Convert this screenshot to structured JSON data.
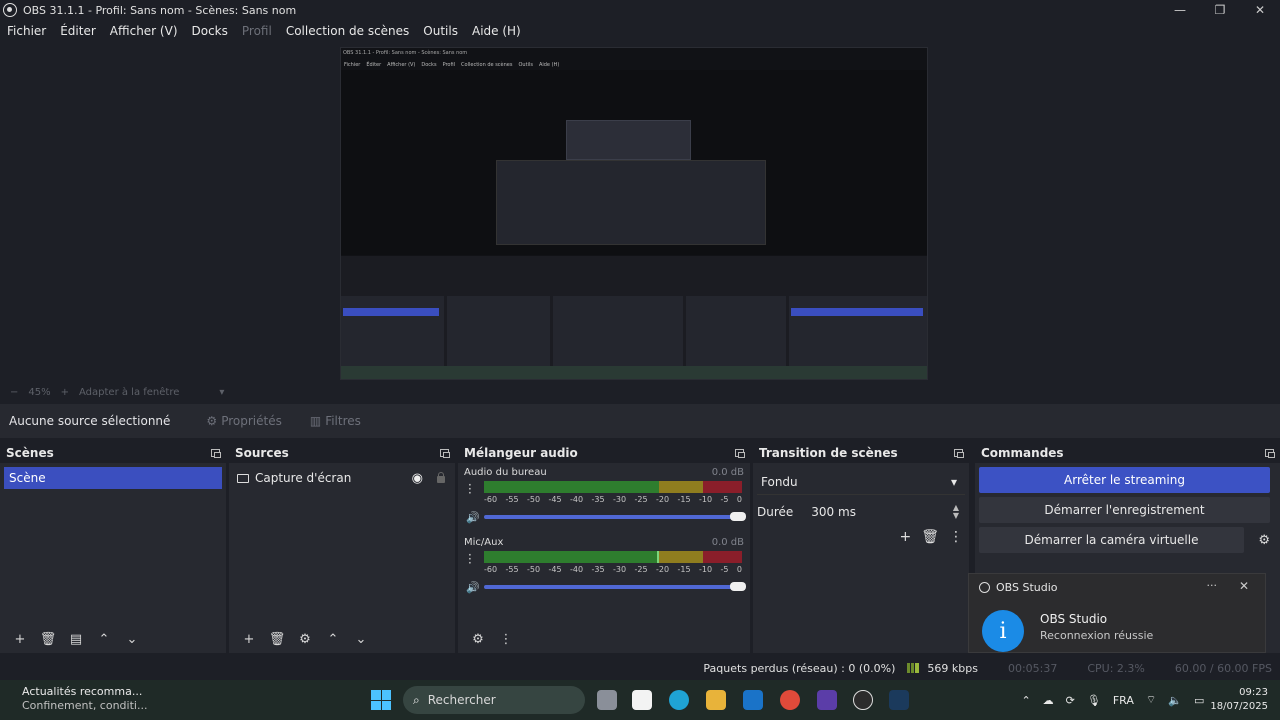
{
  "window": {
    "title": "OBS 31.1.1 - Profil: Sans nom - Scènes: Sans nom",
    "controls": [
      "minimize",
      "maximize",
      "close"
    ]
  },
  "menu": {
    "items": [
      "Fichier",
      "Éditer",
      "Afficher (V)",
      "Docks",
      "Profil",
      "Collection de scènes",
      "Outils",
      "Aide (H)"
    ],
    "disabled_index": 4
  },
  "zoom": {
    "minus": "−",
    "value": "45%",
    "plus": "+",
    "fit_label": "Adapter à la fenêtre"
  },
  "context": {
    "no_source": "Aucune source sélectionné",
    "properties": "Propriétés",
    "filters": "Filtres"
  },
  "scenes": {
    "title": "Scènes",
    "items": [
      "Scène"
    ]
  },
  "sources": {
    "title": "Sources",
    "items": [
      {
        "name": "Capture d'écran",
        "visible": true,
        "locked": false
      }
    ]
  },
  "mixer": {
    "title": "Mélangeur audio",
    "channels": [
      {
        "name": "Audio du bureau",
        "db": "0.0 dB",
        "level": 0.0
      },
      {
        "name": "Mic/Aux",
        "db": "0.0 dB",
        "level": 0.68
      }
    ],
    "ticks": [
      "-60",
      "-55",
      "-50",
      "-45",
      "-40",
      "-35",
      "-30",
      "-25",
      "-20",
      "-15",
      "-10",
      "-5",
      "0"
    ]
  },
  "transitions": {
    "title": "Transition de scènes",
    "selected": "Fondu",
    "duration_label": "Durée",
    "duration_value": "300 ms"
  },
  "controls": {
    "title": "Commandes",
    "stop_streaming": "Arrêter le streaming",
    "start_recording": "Démarrer l'enregistrement",
    "start_virtualcam": "Démarrer la caméra virtuelle"
  },
  "notification": {
    "app": "OBS Studio",
    "title": "OBS Studio",
    "body": "Reconnexion réussie",
    "more": "···",
    "close": "✕"
  },
  "status": {
    "dropped": "Paquets perdus (réseau) : 0 (0.0%)",
    "bitrate": "569 kbps",
    "time1": "00:05:37",
    "cpu": "CPU: 2.3%",
    "fps": "60.00 / 60.00 FPS"
  },
  "taskbar": {
    "news_title": "Actualités recomma...",
    "news_sub": "Confinement, conditi...",
    "search_placeholder": "Rechercher",
    "lang": "FRA",
    "time": "09:23",
    "date": "18/07/2025"
  },
  "colors": {
    "accent": "#3c52c4",
    "meter_green": "#2e7d2e",
    "meter_yellow": "#8f7d1f",
    "meter_red": "#8a1e2a"
  }
}
